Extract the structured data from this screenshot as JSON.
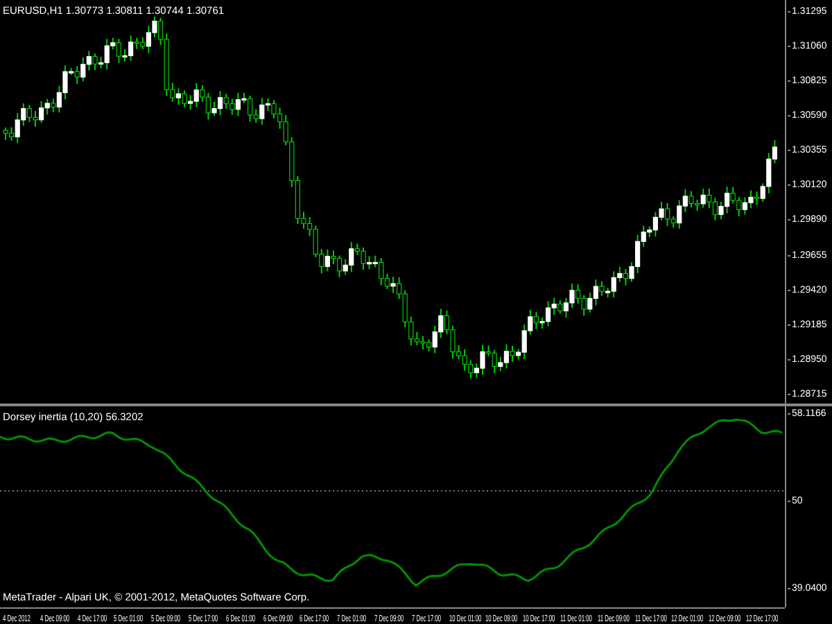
{
  "main_chart": {
    "title": "EURUSD,H1  1.30773 1.30811 1.30744 1.30761",
    "price_axis": [
      "1.31295",
      "1.31060",
      "1.30825",
      "1.30590",
      "1.30355",
      "1.30120",
      "1.29890",
      "1.29655",
      "1.29420",
      "1.29185",
      "1.28950",
      "1.28715"
    ]
  },
  "indicator": {
    "title": "Dorsey inertia (10,20) 56.3202",
    "axis": [
      "58.1166",
      "50",
      "39.0400"
    ],
    "copyright": "MetaTrader - Alpari UK, © 2001-2012, MetaQuotes Software Corp."
  },
  "time_axis": [
    "4 Dec 2012",
    "4 Dec 09:00",
    "4 Dec 17:00",
    "5 Dec 01:00",
    "5 Dec 09:00",
    "5 Dec 17:00",
    "6 Dec 01:00",
    "6 Dec 09:00",
    "6 Dec 17:00",
    "7 Dec 01:00",
    "7 Dec 09:00",
    "7 Dec 17:00",
    "10 Dec 01:00",
    "10 Dec 09:00",
    "10 Dec 17:00",
    "11 Dec 01:00",
    "11 Dec 09:00",
    "11 Dec 17:00",
    "12 Dec 01:00",
    "12 Dec 09:00",
    "12 Dec 17:00"
  ]
}
